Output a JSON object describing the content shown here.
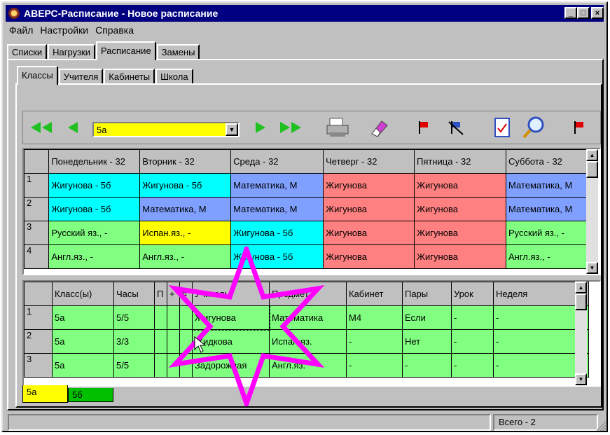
{
  "window": {
    "title": "АВЕРС-Расписание - Новое расписание"
  },
  "menu": [
    "Файл",
    "Настройки",
    "Справка"
  ],
  "tabs": [
    "Списки",
    "Нагрузки",
    "Расписание",
    "Замены"
  ],
  "subtabs": [
    "Классы",
    "Учителя",
    "Кабинеты",
    "Школа"
  ],
  "toolbar": {
    "class_select": "5а"
  },
  "schedule": {
    "headers": [
      "Понедельник - 32",
      "Вторник - 32",
      "Среда - 32",
      "Четверг - 32",
      "Пятница - 32",
      "Суббота - 32"
    ],
    "rows": [
      {
        "n": "1",
        "cells": [
          "Жигунова - 5б",
          "Жигунова - 5б",
          "Математика, М",
          "Жигунова",
          "Жигунова",
          "Математика, М"
        ],
        "colors": [
          "cyan",
          "cyan",
          "blue",
          "red",
          "red",
          "blue"
        ]
      },
      {
        "n": "2",
        "cells": [
          "Жигунова - 5б",
          "Математика, М",
          "Математика, М",
          "Жигунова",
          "Жигунова",
          "Математика, М"
        ],
        "colors": [
          "cyan",
          "blue",
          "blue",
          "red",
          "red",
          "blue"
        ]
      },
      {
        "n": "3",
        "cells": [
          "Русский яз., -",
          "Испан.яз., -",
          "Жигунова - 5б",
          "Жигунова",
          "Жигунова",
          "Русский яз., -"
        ],
        "colors": [
          "green",
          "yellow",
          "cyan",
          "red",
          "red",
          "green"
        ]
      },
      {
        "n": "4",
        "cells": [
          "Англ.яз., -",
          "Англ.яз., -",
          "Жигунова - 5б",
          "Жигунова",
          "Жигунова",
          "Англ.яз., -"
        ],
        "colors": [
          "green",
          "green",
          "cyan",
          "red",
          "red",
          "green"
        ]
      }
    ]
  },
  "load": {
    "headers": [
      "Класс(ы)",
      "Часы",
      "П",
      "+",
      "#",
      "Учитель",
      "Предмет",
      "Кабинет",
      "Пары",
      "Урок",
      "Неделя"
    ],
    "rows": [
      {
        "n": "1",
        "cells": [
          "5а",
          "5/5",
          "",
          "",
          "",
          "Жигунова",
          "Математика",
          "М4",
          "Если",
          "-",
          "-"
        ]
      },
      {
        "n": "2",
        "cells": [
          "5а",
          "3/3",
          "",
          "",
          "",
          "Жидкова",
          "Испан.яз.",
          "-",
          "Нет",
          "-",
          "-"
        ]
      },
      {
        "n": "3",
        "cells": [
          "5а",
          "5/5",
          "",
          "",
          "",
          "Задорожная",
          "Англ.яз.",
          "-",
          "-",
          "-",
          "-"
        ]
      }
    ]
  },
  "bottom_tabs": [
    "5а",
    "5б"
  ],
  "status": {
    "total": "Всего - 2"
  },
  "colors": {
    "cyan": "#00ffff",
    "blue": "#80a0ff",
    "red": "#ff8080",
    "green": "#80ff80",
    "yellow": "#ffff00",
    "title_bar": "#000080",
    "star": "#ff00ff"
  }
}
